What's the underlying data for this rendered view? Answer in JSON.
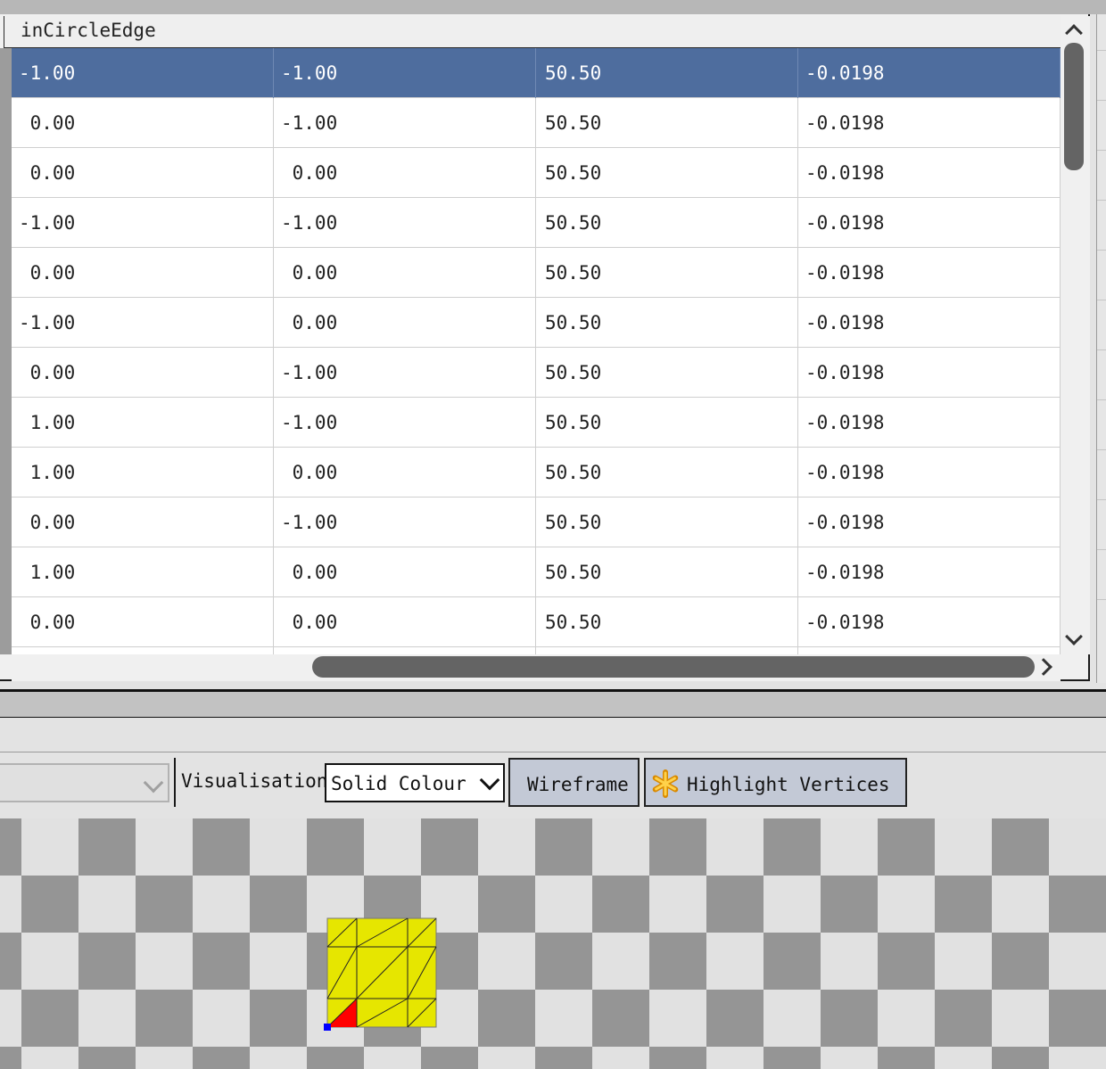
{
  "table": {
    "header_label": "inCircleEdge",
    "selected_row": 0,
    "rows": [
      [
        "-1.00",
        "-1.00",
        "50.50",
        "-0.0198"
      ],
      [
        " 0.00",
        "-1.00",
        "50.50",
        "-0.0198"
      ],
      [
        " 0.00",
        " 0.00",
        "50.50",
        "-0.0198"
      ],
      [
        "-1.00",
        "-1.00",
        "50.50",
        "-0.0198"
      ],
      [
        " 0.00",
        " 0.00",
        "50.50",
        "-0.0198"
      ],
      [
        "-1.00",
        " 0.00",
        "50.50",
        "-0.0198"
      ],
      [
        " 0.00",
        "-1.00",
        "50.50",
        "-0.0198"
      ],
      [
        " 1.00",
        "-1.00",
        "50.50",
        "-0.0198"
      ],
      [
        " 1.00",
        " 0.00",
        "50.50",
        "-0.0198"
      ],
      [
        " 0.00",
        "-1.00",
        "50.50",
        "-0.0198"
      ],
      [
        " 1.00",
        " 0.00",
        "50.50",
        "-0.0198"
      ],
      [
        " 0.00",
        " 0.00",
        "50.50",
        "-0.0198"
      ],
      [
        "",
        "",
        "",
        ""
      ]
    ]
  },
  "toolbar": {
    "visualisation_label": "Visualisation",
    "visualisation_value": "Solid Colour",
    "wireframe_label": "Wireframe",
    "highlight_label": "Highlight Vertices",
    "highlight_icon": "asterisk-icon"
  },
  "viewport": {
    "checker_dark": "#959595",
    "checker_light": "#e1e1e1",
    "mesh_fill": "#e6e600",
    "highlight_triangle": "#ff0000",
    "vertex_marker": "#0000ff"
  }
}
